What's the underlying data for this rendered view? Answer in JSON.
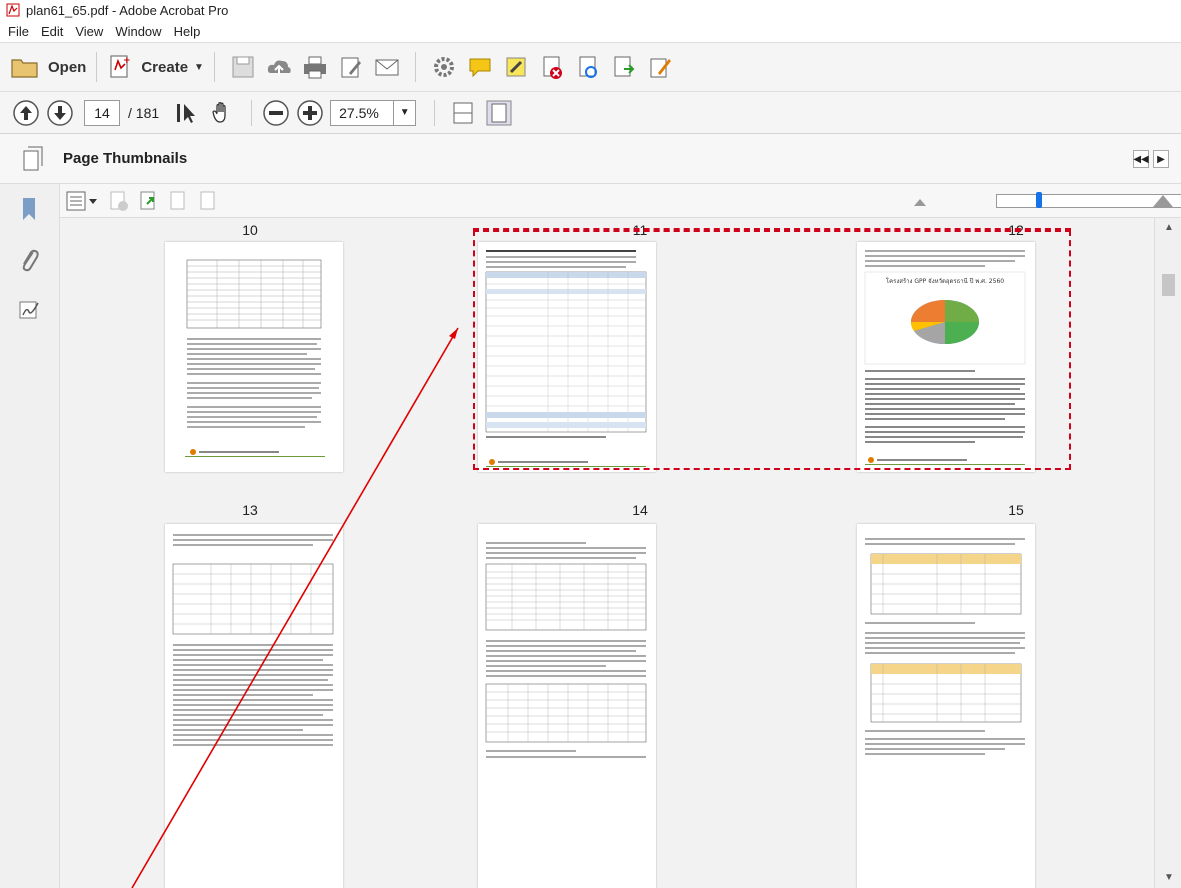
{
  "window": {
    "title": "plan61_65.pdf - Adobe Acrobat Pro"
  },
  "menu": [
    "File",
    "Edit",
    "View",
    "Window",
    "Help"
  ],
  "toolbar": {
    "open_label": "Open",
    "create_label": "Create",
    "page_current": "14",
    "page_total": "/ 181",
    "zoom": "27.5%"
  },
  "panel": {
    "title": "Page Thumbnails"
  },
  "thumbnails": [
    {
      "label": "10"
    },
    {
      "label": "11"
    },
    {
      "label": "12"
    },
    {
      "label": "13"
    },
    {
      "label": "14"
    },
    {
      "label": "15"
    }
  ],
  "chart_card": {
    "title": "โครงสร้าง GPP จังหวัดอุดรธานี ปี พ.ศ. 2560"
  },
  "colors": {
    "accent": "#1473e6",
    "selection": "#d0021b",
    "annotation": "#e00000"
  }
}
